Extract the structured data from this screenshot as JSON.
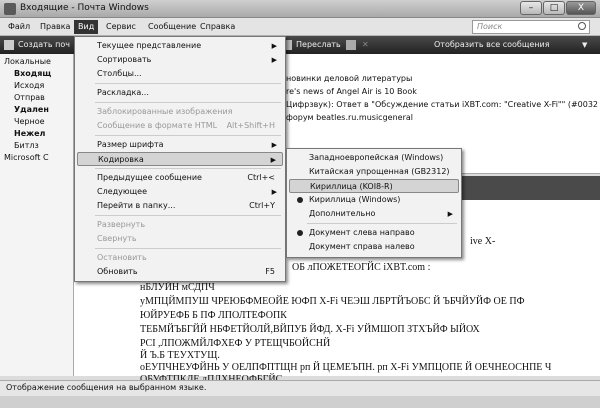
{
  "window": {
    "title": "Входящие - Почта Windows",
    "min": "–",
    "max": "□",
    "close": "X"
  },
  "menubar": {
    "file": "Файл",
    "edit": "Правка",
    "view": "Вид",
    "service": "Сервис",
    "message": "Сообщение",
    "help": "Справка"
  },
  "search": {
    "placeholder": "Поиск"
  },
  "toolbar": {
    "create": "Создать поч",
    "forward": "Переслать",
    "show_all": "Отобразить все сообщения"
  },
  "tree": {
    "items": [
      "Локальные",
      "Входящ",
      "Исходя",
      "Отправ",
      "Удален",
      "Черное",
      "Нежел",
      "Битлз",
      "Microsoft C"
    ]
  },
  "messages": [
    "новинки деловой литературы",
    "re's news of Angel Air is 10 Book",
    "Цифрзвук): Ответ в \"Обсуждение статьи iXBT.com: \"Creative X-Fi\"\" (#003269)",
    "форум beatles.ru.musicgeneral"
  ],
  "preview": {
    "frag1": "ive X-",
    "frag2": "ОБ лПОЖЕТЕОГЙС iXBT.com :",
    "lines": [
      "нБЛУЙН мСДПЧ",
      "уМПЦЙМПУШ ЧРЕЮБФМЕОЙЕ ЮФП X-Fi ЧЕЭШ ЛБРТЙЪОБС Й ЪБЧЙУЙФ ОЕ ПФ",
      "ЮЙРУЕФБ Б ПФ ЛПОЛТЕФОПК",
      "ТЕБМЙЪБГЙЙ НБФЕТЙОЛЙ,ВЙПУБ ЙФД. X-Fi УЙМШОП ЗТХЪЙФ ЫЙОХ",
      "PCI ,ЛПОЖМЙЛФХЕФ У РТЕЩЧБОЙСНЙ",
      "Й Ъ.Б ТЕУХТУЩ.",
      "оЕУПЧНЕУФЙНЬ У ОЕЛПФПТЩН рп Й ЦЕМЕЪПН. рп X-Fi УМПЦОПЕ Й ОЕЧНЕОСНПЕ Ч",
      "ОБУФТПКЛЕ,дПЛХНЕОФБГЙС"
    ]
  },
  "status": "Отображение сообщения на выбранном языке.",
  "view_menu": {
    "items": [
      {
        "label": "Текущее представление",
        "arrow": "▶"
      },
      {
        "label": "Сортировать",
        "arrow": "▶"
      },
      {
        "label": "Столбцы..."
      },
      {
        "label": "Раскладка..."
      },
      {
        "label": "Заблокированные изображения",
        "disabled": true
      },
      {
        "label": "Сообщение в формате HTML",
        "shortcut": "Alt+Shift+H",
        "disabled": true
      },
      {
        "label": "Размер шрифта",
        "arrow": "▶"
      },
      {
        "label": "Кодировка",
        "arrow": "▶"
      },
      {
        "label": "Предыдущее сообщение",
        "shortcut": "Ctrl+<"
      },
      {
        "label": "Следующее",
        "arrow": "▶"
      },
      {
        "label": "Перейти в папку...",
        "shortcut": "Ctrl+Y"
      },
      {
        "label": "Развернуть",
        "disabled": true
      },
      {
        "label": "Свернуть",
        "disabled": true
      },
      {
        "label": "Остановить",
        "disabled": true
      },
      {
        "label": "Обновить",
        "shortcut": "F5"
      }
    ]
  },
  "encoding_menu": {
    "items": [
      {
        "label": "Западноевропейская (Windows)"
      },
      {
        "label": "Китайская упрощенная (GB2312)"
      },
      {
        "label": "Кириллица (KOI8-R)"
      },
      {
        "label": "Кириллица (Windows)"
      },
      {
        "label": "Дополнительно",
        "arrow": "▶"
      },
      {
        "label": "Документ слева направо"
      },
      {
        "label": "Документ справа налево"
      }
    ]
  }
}
